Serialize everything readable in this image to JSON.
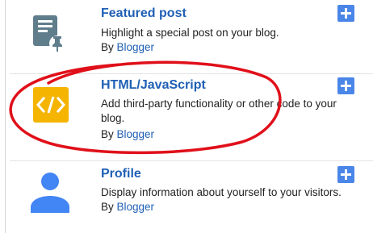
{
  "gadgets": [
    {
      "title": "Featured post",
      "description": "Highlight a special post on your blog.",
      "by_prefix": "By ",
      "author": "Blogger",
      "icon": "featured-post-icon"
    },
    {
      "title": "HTML/JavaScript",
      "description": "Add third-party functionality or other code to your blog.",
      "by_prefix": "By ",
      "author": "Blogger",
      "icon": "code-icon"
    },
    {
      "title": "Profile",
      "description": "Display information about yourself to your visitors.",
      "by_prefix": "By ",
      "author": "Blogger",
      "icon": "person-icon"
    }
  ],
  "colors": {
    "link": "#1f60b5",
    "add_button": "#4a86e8",
    "code_icon_bg": "#f4b400",
    "profile_icon": "#4285f4",
    "featured_icon": "#607d8b",
    "annotation": "#e0101a"
  }
}
